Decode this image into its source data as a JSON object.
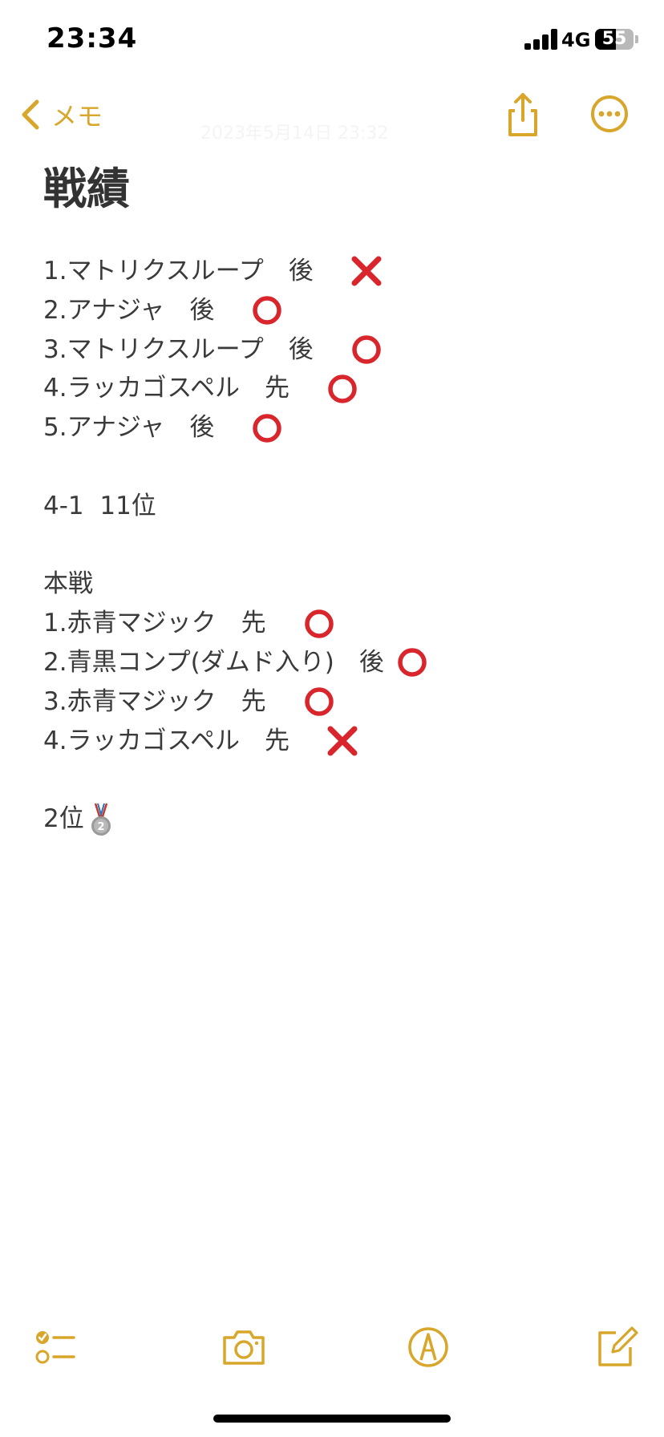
{
  "status_bar": {
    "time": "23:34",
    "network": "4G",
    "battery": "55"
  },
  "nav": {
    "back_label": "メモ",
    "faint_date": "2023年5月14日 23:32"
  },
  "note": {
    "title": "戦績",
    "lines": [
      {
        "text": "1.マトリクスループ　後　",
        "mark": "cross"
      },
      {
        "text": "2.アナジャ　後　",
        "mark": "circle"
      },
      {
        "text": "3.マトリクスループ　後　",
        "mark": "circle"
      },
      {
        "text": "4.ラッカゴスペル　先　",
        "mark": "circle"
      },
      {
        "text": "5.アナジャ　後　",
        "mark": "circle"
      },
      {
        "text": "",
        "mark": ""
      },
      {
        "text": "4-1  11位",
        "mark": ""
      },
      {
        "text": "",
        "mark": ""
      },
      {
        "text": "本戦",
        "mark": ""
      },
      {
        "text": "1.赤青マジック　先　",
        "mark": "circle"
      },
      {
        "text": "2.青黒コンプ(ダムド入り)　後",
        "mark": "circle"
      },
      {
        "text": "3.赤青マジック　先　",
        "mark": "circle"
      },
      {
        "text": "4.ラッカゴスペル　先　",
        "mark": "cross"
      },
      {
        "text": "",
        "mark": ""
      },
      {
        "text": "2位",
        "mark": "medal"
      }
    ]
  },
  "colors": {
    "accent": "#d8a62b",
    "circle_mark": "#d9262c",
    "cross_mark": "#d9262c"
  },
  "icons": {
    "back": "chevron-left-icon",
    "share": "share-icon",
    "more": "ellipsis-circle-icon",
    "checklist": "checklist-icon",
    "camera": "camera-icon",
    "markup": "markup-pen-icon",
    "compose": "compose-icon"
  }
}
